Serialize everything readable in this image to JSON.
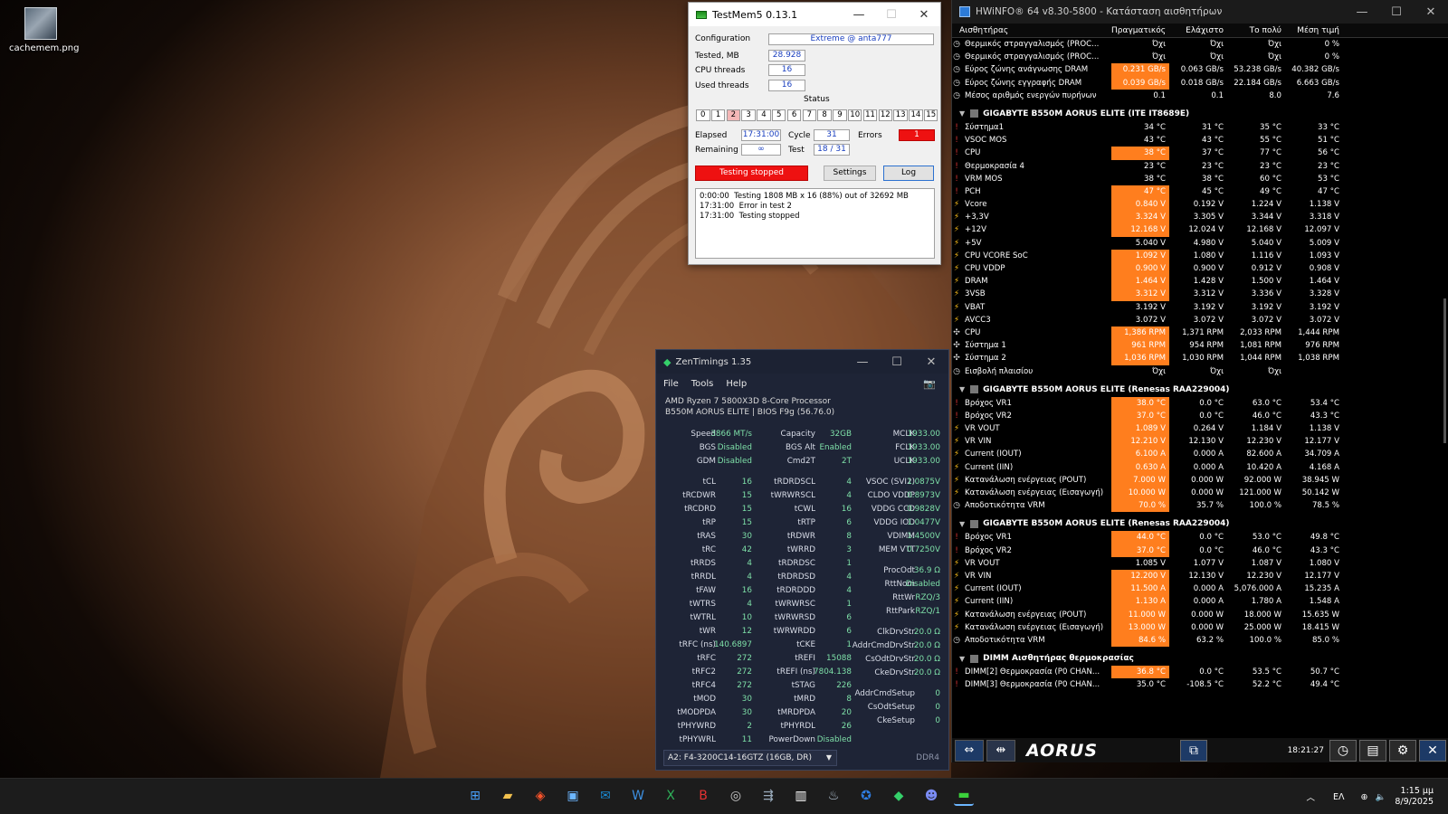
{
  "desktop": {
    "icon_label": "cachemem.png"
  },
  "testmem5": {
    "title": "TestMem5  0.13.1",
    "configuration_label": "Configuration",
    "configuration_value": "Extreme @ anta777",
    "tested_label": "Tested, MB",
    "tested_value": "28.928",
    "cpu_threads_label": "CPU threads",
    "cpu_threads_value": "16",
    "used_threads_label": "Used threads",
    "used_threads_value": "16",
    "status_label": "Status",
    "threads": [
      "0",
      "1",
      "2",
      "3",
      "4",
      "5",
      "6",
      "7",
      "8",
      "9",
      "10",
      "11",
      "12",
      "13",
      "14",
      "15"
    ],
    "error_thread": "2",
    "elapsed_label": "Elapsed",
    "elapsed_value": "17:31:00",
    "cycle_label": "Cycle",
    "cycle_value": "31",
    "errors_label": "Errors",
    "errors_value": "1",
    "remaining_label": "Remaining",
    "remaining_value": "∞",
    "test_label": "Test",
    "test_value": "18 / 31",
    "stopped_label": "Testing stopped",
    "settings_label": "Settings",
    "log_label": "Log",
    "log_lines": [
      "0:00:00  Testing 1808 MB x 16 (88%) out of 32692 MB",
      "17:31:00  Error in test 2",
      "17:31:00  Testing stopped"
    ],
    "colors": {
      "error": "#ee1111",
      "accent": "#1a3fbf"
    }
  },
  "hwinfo": {
    "title": "HWiNFO® 64 v8.30-5800 - Κατάσταση αισθητήρων",
    "columns": [
      "Αισθητήρας",
      "Πραγματικός",
      "Ελάχιστο",
      "Το πολύ",
      "Μέση τιμή"
    ],
    "sections": [
      {
        "title": "",
        "rows": [
          {
            "icon": "clock",
            "name": "Θερμικός στραγγαλισμός (PROC...",
            "values": [
              "Όχι",
              "Όχι",
              "Όχι",
              "0 %"
            ],
            "hl": false
          },
          {
            "icon": "clock",
            "name": "Θερμικός στραγγαλισμός (PROC...",
            "values": [
              "Όχι",
              "Όχι",
              "Όχι",
              "0 %"
            ],
            "hl": false
          },
          {
            "icon": "clock",
            "name": "Εύρος ζώνης ανάγνωσης DRAM",
            "values": [
              "0.231 GB/s",
              "0.063 GB/s",
              "53.238 GB/s",
              "40.382 GB/s"
            ],
            "hl": true
          },
          {
            "icon": "clock",
            "name": "Εύρος ζώνης εγγραφής DRAM",
            "values": [
              "0.039 GB/s",
              "0.018 GB/s",
              "22.184 GB/s",
              "6.663 GB/s"
            ],
            "hl": true
          },
          {
            "icon": "clock",
            "name": "Μέσος αριθμός ενεργών πυρήνων",
            "values": [
              "0.1",
              "0.1",
              "8.0",
              "7.6"
            ],
            "hl": false
          }
        ]
      },
      {
        "title": "GIGABYTE B550M AORUS ELITE (ITE IT8689E)",
        "rows": [
          {
            "icon": "temp",
            "name": "Σύστημα1",
            "values": [
              "34 °C",
              "31 °C",
              "35 °C",
              "33 °C"
            ],
            "hl": false
          },
          {
            "icon": "temp",
            "name": "VSOC MOS",
            "values": [
              "43 °C",
              "43 °C",
              "55 °C",
              "51 °C"
            ],
            "hl": false
          },
          {
            "icon": "temp",
            "name": "CPU",
            "values": [
              "38 °C",
              "37 °C",
              "77 °C",
              "56 °C"
            ],
            "hl": true
          },
          {
            "icon": "temp",
            "name": "Θερμοκρασία 4",
            "values": [
              "23 °C",
              "23 °C",
              "23 °C",
              "23 °C"
            ],
            "hl": false
          },
          {
            "icon": "temp",
            "name": "VRM MOS",
            "values": [
              "38 °C",
              "38 °C",
              "60 °C",
              "53 °C"
            ],
            "hl": false
          },
          {
            "icon": "temp",
            "name": "PCH",
            "values": [
              "47 °C",
              "45 °C",
              "49 °C",
              "47 °C"
            ],
            "hl": true
          },
          {
            "icon": "volt",
            "name": "Vcore",
            "values": [
              "0.840 V",
              "0.192 V",
              "1.224 V",
              "1.138 V"
            ],
            "hl": true
          },
          {
            "icon": "volt",
            "name": "+3,3V",
            "values": [
              "3.324 V",
              "3.305 V",
              "3.344 V",
              "3.318 V"
            ],
            "hl": true
          },
          {
            "icon": "volt",
            "name": "+12V",
            "values": [
              "12.168 V",
              "12.024 V",
              "12.168 V",
              "12.097 V"
            ],
            "hl": true
          },
          {
            "icon": "volt",
            "name": "+5V",
            "values": [
              "5.040 V",
              "4.980 V",
              "5.040 V",
              "5.009 V"
            ],
            "hl": false
          },
          {
            "icon": "volt",
            "name": "CPU VCORE SoC",
            "values": [
              "1.092 V",
              "1.080 V",
              "1.116 V",
              "1.093 V"
            ],
            "hl": true
          },
          {
            "icon": "volt",
            "name": "CPU VDDP",
            "values": [
              "0.900 V",
              "0.900 V",
              "0.912 V",
              "0.908 V"
            ],
            "hl": true
          },
          {
            "icon": "volt",
            "name": "DRAM",
            "values": [
              "1.464 V",
              "1.428 V",
              "1.500 V",
              "1.464 V"
            ],
            "hl": true
          },
          {
            "icon": "volt",
            "name": "3VSB",
            "values": [
              "3.312 V",
              "3.312 V",
              "3.336 V",
              "3.328 V"
            ],
            "hl": true
          },
          {
            "icon": "volt",
            "name": "VBAT",
            "values": [
              "3.192 V",
              "3.192 V",
              "3.192 V",
              "3.192 V"
            ],
            "hl": false
          },
          {
            "icon": "volt",
            "name": "AVCC3",
            "values": [
              "3.072 V",
              "3.072 V",
              "3.072 V",
              "3.072 V"
            ],
            "hl": false
          },
          {
            "icon": "fan",
            "name": "CPU",
            "values": [
              "1,386 RPM",
              "1,371 RPM",
              "2,033 RPM",
              "1,444 RPM"
            ],
            "hl": true
          },
          {
            "icon": "fan",
            "name": "Σύστημα 1",
            "values": [
              "961 RPM",
              "954 RPM",
              "1,081 RPM",
              "976 RPM"
            ],
            "hl": true
          },
          {
            "icon": "fan",
            "name": "Σύστημα 2",
            "values": [
              "1,036 RPM",
              "1,030 RPM",
              "1,044 RPM",
              "1,038 RPM"
            ],
            "hl": true
          },
          {
            "icon": "clock",
            "name": "Εισβολή πλαισίου",
            "values": [
              "Όχι",
              "Όχι",
              "Όχι",
              ""
            ],
            "hl": false
          }
        ]
      },
      {
        "title": "GIGABYTE B550M AORUS ELITE (Renesas RAA229004)",
        "rows": [
          {
            "icon": "temp",
            "name": "Βρόχος VR1",
            "values": [
              "38.0 °C",
              "0.0 °C",
              "63.0 °C",
              "53.4 °C"
            ],
            "hl": true
          },
          {
            "icon": "temp",
            "name": "Βρόχος VR2",
            "values": [
              "37.0 °C",
              "0.0 °C",
              "46.0 °C",
              "43.3 °C"
            ],
            "hl": true
          },
          {
            "icon": "volt",
            "name": "VR VOUT",
            "values": [
              "1.089 V",
              "0.264 V",
              "1.184 V",
              "1.138 V"
            ],
            "hl": true
          },
          {
            "icon": "volt",
            "name": "VR VIN",
            "values": [
              "12.210 V",
              "12.130 V",
              "12.230 V",
              "12.177 V"
            ],
            "hl": true
          },
          {
            "icon": "volt",
            "name": "Current (IOUT)",
            "values": [
              "6.100 A",
              "0.000 A",
              "82.600 A",
              "34.709 A"
            ],
            "hl": true
          },
          {
            "icon": "volt",
            "name": "Current (IIN)",
            "values": [
              "0.630 A",
              "0.000 A",
              "10.420 A",
              "4.168 A"
            ],
            "hl": true
          },
          {
            "icon": "volt",
            "name": "Κατανάλωση ενέργειας (POUT)",
            "values": [
              "7.000 W",
              "0.000 W",
              "92.000 W",
              "38.945 W"
            ],
            "hl": true
          },
          {
            "icon": "volt",
            "name": "Κατανάλωση ενέργειας (Εισαγωγή)",
            "values": [
              "10.000 W",
              "0.000 W",
              "121.000 W",
              "50.142 W"
            ],
            "hl": true
          },
          {
            "icon": "clock",
            "name": "Αποδοτικότητα VRM",
            "values": [
              "70.0 %",
              "35.7 %",
              "100.0 %",
              "78.5 %"
            ],
            "hl": true
          }
        ]
      },
      {
        "title": "GIGABYTE B550M AORUS ELITE (Renesas RAA229004)",
        "rows": [
          {
            "icon": "temp",
            "name": "Βρόχος VR1",
            "values": [
              "44.0 °C",
              "0.0 °C",
              "53.0 °C",
              "49.8 °C"
            ],
            "hl": true
          },
          {
            "icon": "temp",
            "name": "Βρόχος VR2",
            "values": [
              "37.0 °C",
              "0.0 °C",
              "46.0 °C",
              "43.3 °C"
            ],
            "hl": true
          },
          {
            "icon": "volt",
            "name": "VR VOUT",
            "values": [
              "1.085 V",
              "1.077 V",
              "1.087 V",
              "1.080 V"
            ],
            "hl": false
          },
          {
            "icon": "volt",
            "name": "VR VIN",
            "values": [
              "12.200 V",
              "12.130 V",
              "12.230 V",
              "12.177 V"
            ],
            "hl": true
          },
          {
            "icon": "volt",
            "name": "Current (IOUT)",
            "values": [
              "11.500 A",
              "0.000 A",
              "5,076.000 A",
              "15.235 A"
            ],
            "hl": true
          },
          {
            "icon": "volt",
            "name": "Current (IIN)",
            "values": [
              "1.130 A",
              "0.000 A",
              "1.780 A",
              "1.548 A"
            ],
            "hl": true
          },
          {
            "icon": "volt",
            "name": "Κατανάλωση ενέργειας (POUT)",
            "values": [
              "11.000 W",
              "0.000 W",
              "18.000 W",
              "15.635 W"
            ],
            "hl": true
          },
          {
            "icon": "volt",
            "name": "Κατανάλωση ενέργειας (Εισαγωγή)",
            "values": [
              "13.000 W",
              "0.000 W",
              "25.000 W",
              "18.415 W"
            ],
            "hl": true
          },
          {
            "icon": "clock",
            "name": "Αποδοτικότητα VRM",
            "values": [
              "84.6 %",
              "63.2 %",
              "100.0 %",
              "85.0 %"
            ],
            "hl": true
          }
        ]
      },
      {
        "title": "DIMM Αισθητήρας θερμοκρασίας",
        "rows": [
          {
            "icon": "temp",
            "name": "DIMM[2] Θερμοκρασία (P0 CHAN...",
            "values": [
              "36.8 °C",
              "0.0 °C",
              "53.5 °C",
              "50.7 °C"
            ],
            "hl": true
          },
          {
            "icon": "temp",
            "name": "DIMM[3] Θερμοκρασία (P0 CHAN...",
            "values": [
              "35.0 °C",
              "-108.5 °C",
              "52.2 °C",
              "49.4 °C"
            ],
            "hl": false
          }
        ]
      }
    ],
    "brand": "AORUS",
    "elapsed": "18:21:27",
    "colors": {
      "highlight": "#ff7e1e"
    }
  },
  "zentimings": {
    "title": "ZenTimings 1.35",
    "menu": [
      "File",
      "Tools",
      "Help"
    ],
    "cpu": "AMD Ryzen 7 5800X3D 8-Core Processor",
    "board": "B550M AORUS ELITE | BIOS F9g (56.76.0)",
    "col1": [
      [
        "Speed",
        "3866 MT/s"
      ],
      [
        "BGS",
        "Disabled"
      ],
      [
        "GDM",
        "Disabled"
      ],
      [
        "",
        ""
      ],
      [
        "tCL",
        "16"
      ],
      [
        "tRCDWR",
        "15"
      ],
      [
        "tRCDRD",
        "15"
      ],
      [
        "tRP",
        "15"
      ],
      [
        "tRAS",
        "30"
      ],
      [
        "tRC",
        "42"
      ],
      [
        "tRRDS",
        "4"
      ],
      [
        "tRRDL",
        "4"
      ],
      [
        "tFAW",
        "16"
      ],
      [
        "tWTRS",
        "4"
      ],
      [
        "tWTRL",
        "10"
      ],
      [
        "tWR",
        "12"
      ],
      [
        "tRFC (ns)",
        "140.6897"
      ],
      [
        "tRFC",
        "272"
      ],
      [
        "tRFC2",
        "272"
      ],
      [
        "tRFC4",
        "272"
      ],
      [
        "tMOD",
        "30"
      ],
      [
        "tMODPDA",
        "30"
      ],
      [
        "tPHYWRD",
        "2"
      ],
      [
        "tPHYWRL",
        "11"
      ]
    ],
    "col2": [
      [
        "Capacity",
        "32GB"
      ],
      [
        "BGS Alt",
        "Enabled"
      ],
      [
        "Cmd2T",
        "2T"
      ],
      [
        "",
        ""
      ],
      [
        "tRDRDSCL",
        "4"
      ],
      [
        "tWRWRSCL",
        "4"
      ],
      [
        "tCWL",
        "16"
      ],
      [
        "tRTP",
        "6"
      ],
      [
        "tRDWR",
        "8"
      ],
      [
        "tWRRD",
        "3"
      ],
      [
        "tRDRDSC",
        "1"
      ],
      [
        "tRDRDSD",
        "4"
      ],
      [
        "tRDRDDD",
        "4"
      ],
      [
        "tWRWRSC",
        "1"
      ],
      [
        "tWRWRSD",
        "6"
      ],
      [
        "tWRWRDD",
        "6"
      ],
      [
        "tCKE",
        "1"
      ],
      [
        "tREFI",
        "15088"
      ],
      [
        "tREFI (ns)",
        "7804.138"
      ],
      [
        "tSTAG",
        "226"
      ],
      [
        "tMRD",
        "8"
      ],
      [
        "tMRDPDA",
        "20"
      ],
      [
        "tPHYRDL",
        "26"
      ],
      [
        "PowerDown",
        "Disabled"
      ]
    ],
    "col3": [
      [
        "MCLK",
        "1933.00"
      ],
      [
        "FCLK",
        "1933.00"
      ],
      [
        "UCLK",
        "1933.00"
      ],
      [
        "",
        ""
      ],
      [
        "VSOC (SVI2)",
        "1.0875V"
      ],
      [
        "CLDO VDDP",
        "0.8973V"
      ],
      [
        "VDDG CCD",
        "0.9828V"
      ],
      [
        "VDDG IOD",
        "1.0477V"
      ],
      [
        "VDIMM",
        "1.4500V"
      ],
      [
        "MEM VTT",
        "0.7250V"
      ],
      [
        "",
        ""
      ],
      [
        "ProcOdt",
        "36.9 Ω"
      ],
      [
        "RttNom",
        "Disabled"
      ],
      [
        "RttWr",
        "RZQ/3"
      ],
      [
        "RttPark",
        "RZQ/1"
      ],
      [
        "",
        ""
      ],
      [
        "ClkDrvStr",
        "20.0 Ω"
      ],
      [
        "AddrCmdDrvStr",
        "20.0 Ω"
      ],
      [
        "CsOdtDrvStr",
        "20.0 Ω"
      ],
      [
        "CkeDrvStr",
        "20.0 Ω"
      ],
      [
        "",
        ""
      ],
      [
        "AddrCmdSetup",
        "0"
      ],
      [
        "CsOdtSetup",
        "0"
      ],
      [
        "CkeSetup",
        "0"
      ]
    ],
    "module": "A2: F4-3200C14-16GTZ (16GB, DR)",
    "ddr": "DDR4",
    "colors": {
      "value": "#7ee0a8",
      "bg": "#1e2436"
    }
  },
  "taskbar": {
    "lang": "ΕΛ",
    "time": "1:15 μμ",
    "date": "8/9/2025"
  }
}
